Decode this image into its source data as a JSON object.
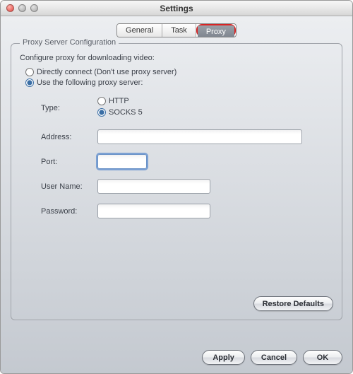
{
  "window": {
    "title": "Settings"
  },
  "tabs": {
    "general": "General",
    "task": "Task",
    "proxy": "Proxy"
  },
  "group": {
    "title": "Proxy Server Configuration",
    "description": "Configure proxy for downloading video:"
  },
  "mode": {
    "direct": "Directly connect (Don't use proxy server)",
    "useProxy": "Use the following proxy server:"
  },
  "fields": {
    "typeLabel": "Type:",
    "httpLabel": "HTTP",
    "socksLabel": "SOCKS 5",
    "addressLabel": "Address:",
    "addressValue": "",
    "portLabel": "Port:",
    "portValue": "",
    "userLabel": "User Name:",
    "userValue": "",
    "passLabel": "Password:",
    "passValue": ""
  },
  "buttons": {
    "restore": "Restore Defaults",
    "apply": "Apply",
    "cancel": "Cancel",
    "ok": "OK"
  }
}
